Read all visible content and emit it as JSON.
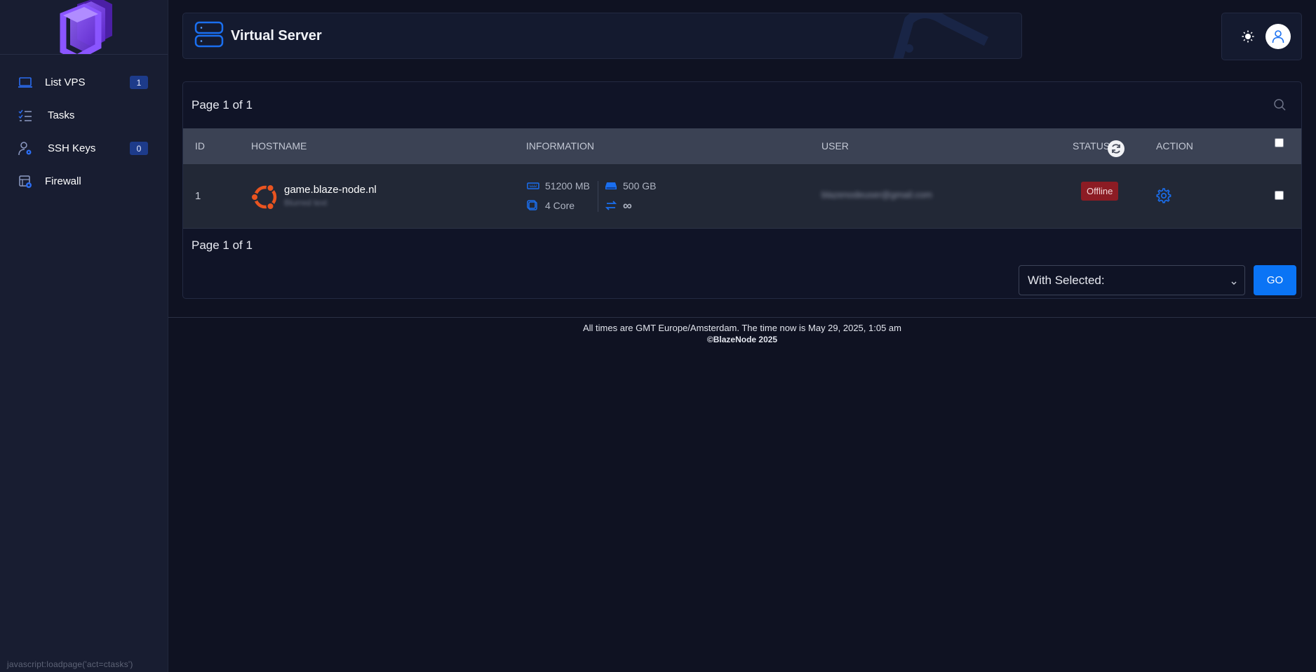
{
  "sidebar": {
    "items": [
      {
        "label": "List VPS",
        "badge": "1",
        "icon": "laptop-icon"
      },
      {
        "label": "Tasks",
        "icon": "task-list-icon"
      },
      {
        "label": "SSH Keys",
        "badge": "0",
        "icon": "user-key-icon"
      },
      {
        "label": "Firewall",
        "icon": "firewall-icon"
      }
    ],
    "status_url": "javascript:loadpage('act=ctasks')"
  },
  "header": {
    "title": "Virtual Server",
    "icon": "server-icon"
  },
  "topbar": {
    "theme_icon": "sun-icon",
    "profile_icon": "user-icon"
  },
  "table": {
    "page_info_top": "Page 1 of 1",
    "page_info_bottom": "Page 1 of 1",
    "columns": {
      "id": "ID",
      "hostname": "HOSTNAME",
      "information": "INFORMATION",
      "user": "USER",
      "status": "STATUS",
      "action": "ACTION"
    },
    "rows": [
      {
        "id": "1",
        "os_icon": "ubuntu-icon",
        "hostname": "game.blaze-node.nl",
        "host_sub": "Blurred text",
        "ram": "51200 MB",
        "disk": "500 GB",
        "cores": "4 Core",
        "bandwidth": "∞",
        "user": "blazenodeuser@gmail.com",
        "status": "Offline"
      }
    ],
    "bulk_action": {
      "placeholder": "With Selected:",
      "go_label": "GO"
    }
  },
  "footer": {
    "time_text": "All times are GMT Europe/Amsterdam. The time now is May 29, 2025, 1:05 am",
    "copyright": "©BlazeNode 2025"
  },
  "colors": {
    "accent": "#0a74f5",
    "offline": "#8c1c24",
    "logo": "#7b3ff2",
    "ubuntu": "#e95420"
  }
}
